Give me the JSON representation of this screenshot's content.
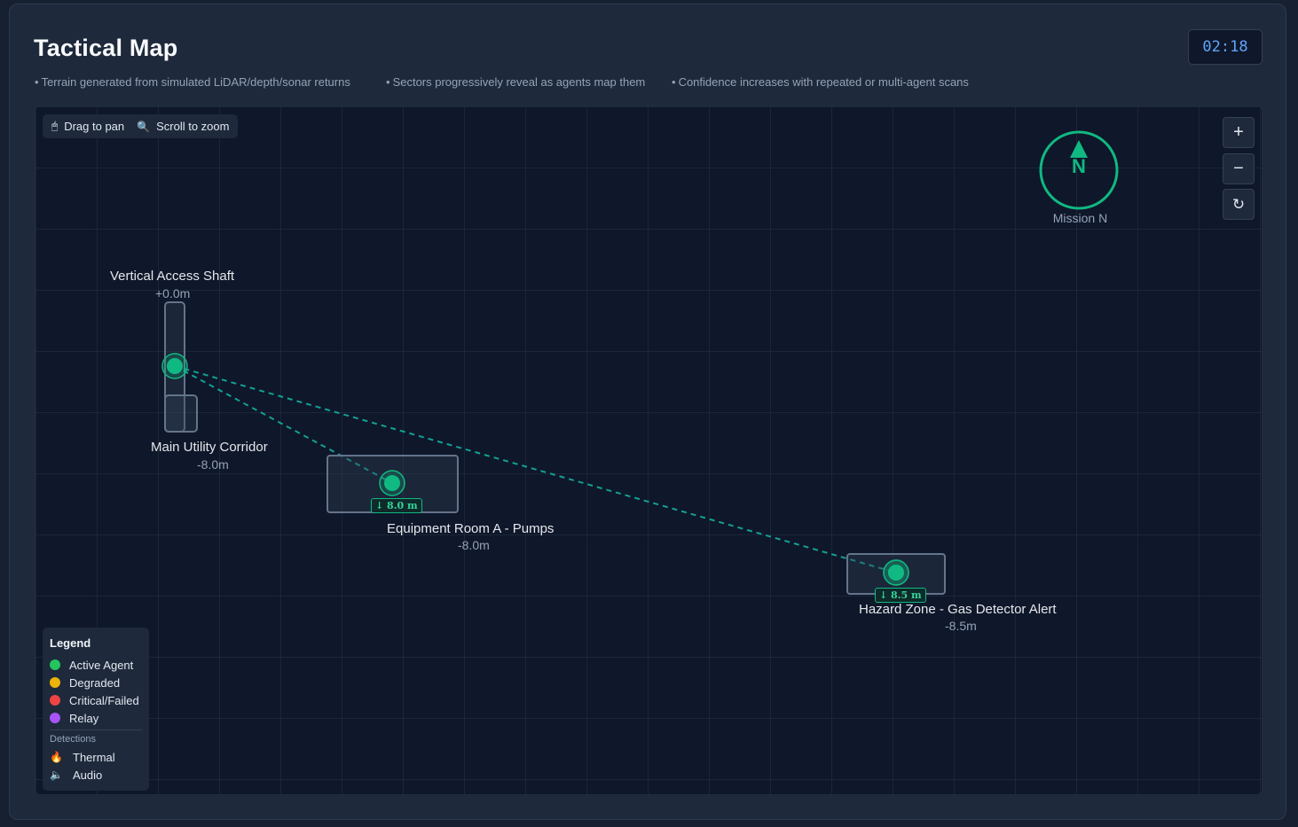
{
  "header": {
    "title": "Tactical Map",
    "timer": "02:18",
    "notes": [
      "Terrain generated from simulated LiDAR/depth/sonar returns",
      "Sectors progressively reveal as agents map them",
      "Confidence increases with repeated or multi-agent scans"
    ]
  },
  "map": {
    "hint": {
      "pan": "Drag to pan",
      "zoom": "Scroll to zoom",
      "pan_icon": "mouse-icon",
      "zoom_icon": "magnifier-icon"
    },
    "controls": {
      "zoom_in": "+",
      "zoom_out": "−",
      "reset": "↻"
    },
    "compass": {
      "letter": "N",
      "label": "Mission N"
    },
    "zones": [
      {
        "name": "Vertical Access Shaft",
        "depth": "+0.0m"
      },
      {
        "name": "Main Utility Corridor",
        "depth": "-8.0m"
      },
      {
        "name": "Equipment Room A - Pumps",
        "depth": "-8.0m",
        "agent_depth": "↓ 8.0 m"
      },
      {
        "name": "Hazard Zone - Gas Detector Alert",
        "depth": "-8.5m",
        "agent_depth": "↓ 8.5 m"
      }
    ],
    "link_status": "active"
  },
  "legend": {
    "title": "Legend",
    "items": [
      {
        "label": "Active Agent",
        "color": "#22c55e"
      },
      {
        "label": "Degraded",
        "color": "#eab308"
      },
      {
        "label": "Critical/Failed",
        "color": "#ef4444"
      },
      {
        "label": "Relay",
        "color": "#a855f7"
      }
    ],
    "detections_title": "Detections",
    "detections": [
      {
        "label": "Thermal",
        "icon": "flame-icon"
      },
      {
        "label": "Audio",
        "icon": "speaker-icon"
      }
    ]
  },
  "colors": {
    "agent": "#10b981",
    "link": "#14b8a6",
    "timer": "#60a5fa"
  }
}
